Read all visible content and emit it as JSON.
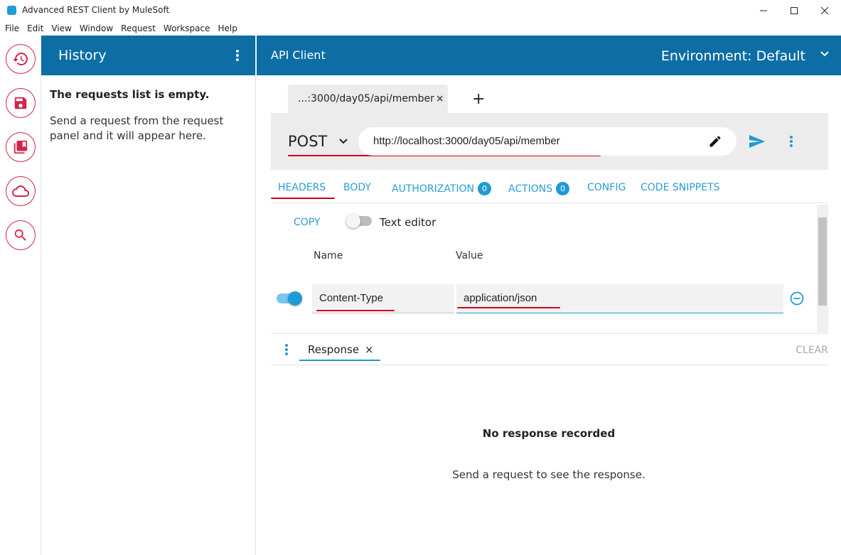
{
  "window": {
    "title": "Advanced REST Client by MuleSoft",
    "minimize_icon": "minimize-icon",
    "maximize_icon": "maximize-icon",
    "close_icon": "close-icon"
  },
  "menu": [
    "File",
    "Edit",
    "View",
    "Window",
    "Request",
    "Workspace",
    "Help"
  ],
  "rail": {
    "items": [
      {
        "name": "history",
        "icon": "history-icon"
      },
      {
        "name": "saved",
        "icon": "save-icon"
      },
      {
        "name": "projects",
        "icon": "collections-icon"
      },
      {
        "name": "exchange",
        "icon": "cloud-icon"
      },
      {
        "name": "search",
        "icon": "search-icon"
      }
    ]
  },
  "history": {
    "title": "History",
    "empty_title": "The requests list is empty.",
    "empty_text": "Send a request from the request panel and it will appear here."
  },
  "main": {
    "title": "API Client",
    "environment": "Environment: Default"
  },
  "request_tab": {
    "label": "...:3000/day05/api/member",
    "close": "×",
    "add": "+"
  },
  "request": {
    "method": "POST",
    "url": "http://localhost:3000/day05/api/member"
  },
  "editor_tabs": {
    "headers": "HEADERS",
    "body": "BODY",
    "authorization": "AUTHORIZATION",
    "authorization_count": "0",
    "actions": "ACTIONS",
    "actions_count": "0",
    "config": "CONFIG",
    "code_snippets": "CODE SNIPPETS",
    "active": "HEADERS"
  },
  "headers_editor": {
    "copy": "COPY",
    "text_editor_label": "Text editor",
    "text_editor_on": false,
    "name_column": "Name",
    "value_column": "Value",
    "rows": [
      {
        "enabled": true,
        "name": "Content-Type",
        "value": "application/json"
      }
    ]
  },
  "response": {
    "tab_label": "Response",
    "tab_close": "×",
    "clear": "CLEAR",
    "empty_title": "No response recorded",
    "empty_text": "Send a request to see the response."
  },
  "colors": {
    "header_blue": "#0c6ea5",
    "accent_blue": "#1e9ad6",
    "rail_red": "#d6234a",
    "annotation_red": "#d0021b"
  }
}
